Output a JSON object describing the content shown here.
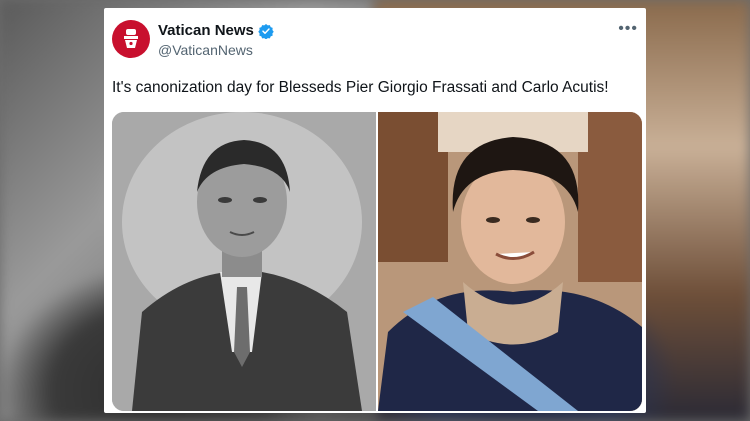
{
  "post": {
    "author_name": "Vatican News",
    "handle": "@VaticanNews",
    "verified": true,
    "text": "It's canonization day for Blesseds Pier Giorgio Frassati and Carlo Acutis!",
    "more_icon": "more-horizontal-icon",
    "media": [
      {
        "name": "photo-left",
        "description_icon": "portrait-photo"
      },
      {
        "name": "photo-right",
        "description_icon": "portrait-photo"
      }
    ]
  },
  "colors": {
    "brand_red": "#c8102e",
    "verified_blue": "#1d9bf0",
    "text_primary": "#0f1419",
    "text_secondary": "#536471"
  }
}
